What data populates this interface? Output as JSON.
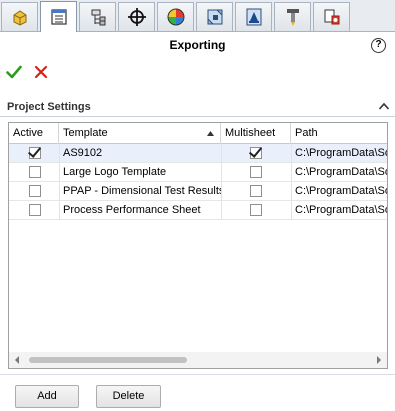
{
  "tabs": [
    {
      "name": "feature-manager",
      "icon": "feature-manager-icon"
    },
    {
      "name": "property-manager",
      "icon": "property-manager-icon"
    },
    {
      "name": "configuration-manager",
      "icon": "configuration-manager-icon"
    },
    {
      "name": "dimxpert-manager",
      "icon": "crosshair-icon"
    },
    {
      "name": "display-manager",
      "icon": "appearance-ball-icon"
    },
    {
      "name": "cam",
      "icon": "cam-icon"
    },
    {
      "name": "inspection",
      "icon": "inspection-icon"
    },
    {
      "name": "toolbox",
      "icon": "tool-icon"
    },
    {
      "name": "addin",
      "icon": "addin-icon"
    }
  ],
  "panel": {
    "title": "Exporting",
    "help_label": "?"
  },
  "section": {
    "title": "Project Settings"
  },
  "grid": {
    "columns": [
      "Active",
      "Template",
      "Multisheet",
      "Path"
    ],
    "sort_column": "Template",
    "sort_direction": "ascending",
    "rows": [
      {
        "active": true,
        "template": "AS9102",
        "multisheet": true,
        "path": "C:\\ProgramData\\Sol",
        "selected": true
      },
      {
        "active": false,
        "template": "Large Logo Template",
        "multisheet": false,
        "path": "C:\\ProgramData\\Sol",
        "selected": false
      },
      {
        "active": false,
        "template": "PPAP - Dimensional Test Results",
        "multisheet": false,
        "path": "C:\\ProgramData\\Sol",
        "selected": false
      },
      {
        "active": false,
        "template": "Process Performance Sheet",
        "multisheet": false,
        "path": "C:\\ProgramData\\Sol",
        "selected": false
      }
    ]
  },
  "buttons": {
    "add": "Add",
    "delete": "Delete"
  },
  "colors": {
    "ok_green": "#2e9a1e",
    "cancel_red": "#d4231b",
    "selected_row": "#e9f0fb"
  }
}
